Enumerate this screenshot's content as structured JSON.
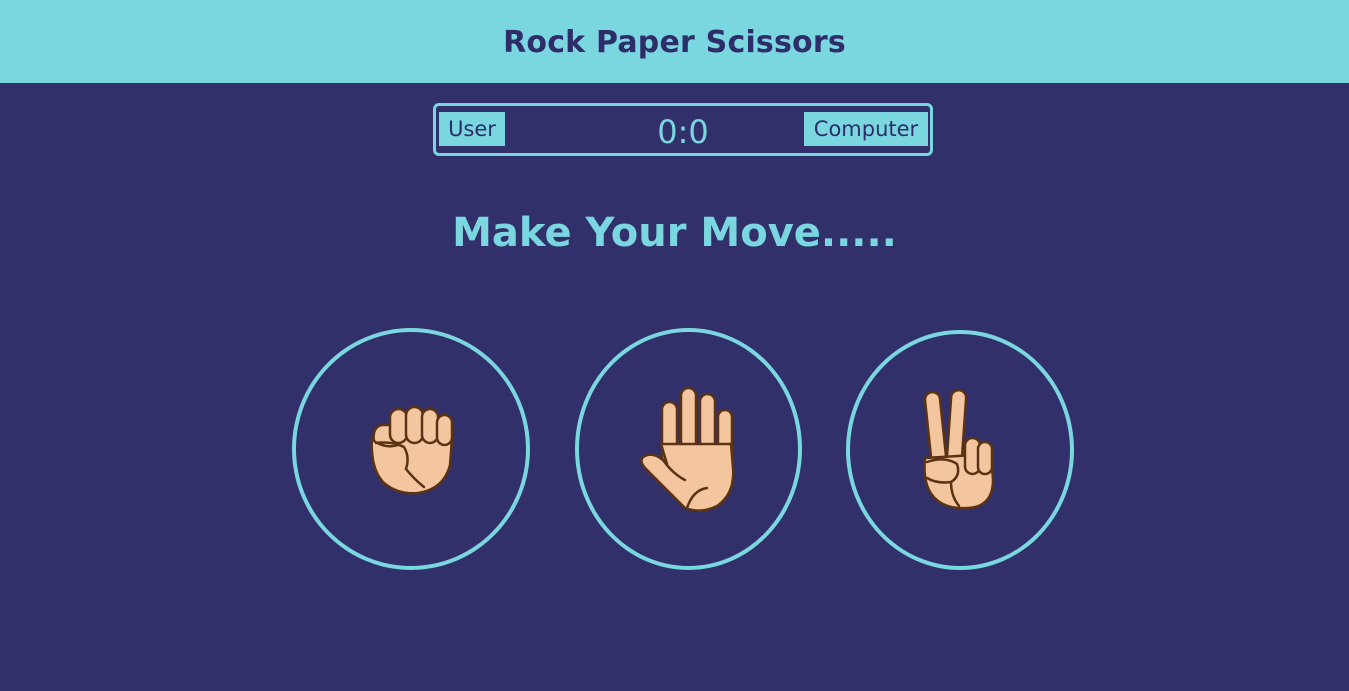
{
  "header": {
    "title": "Rock Paper Scissors"
  },
  "scoreboard": {
    "user_label": "User",
    "computer_label": "Computer",
    "score": "0:0"
  },
  "prompt": "Make Your Move.....",
  "choices": [
    {
      "name": "rock",
      "icon": "fist-icon"
    },
    {
      "name": "paper",
      "icon": "open-hand-icon"
    },
    {
      "name": "scissors",
      "icon": "victory-hand-icon"
    }
  ],
  "colors": {
    "background": "#31306a",
    "accent": "#7ad6df",
    "header_text": "#2e2d6a",
    "skin": "#f3c6a0",
    "skin_outline": "#5a3315"
  }
}
